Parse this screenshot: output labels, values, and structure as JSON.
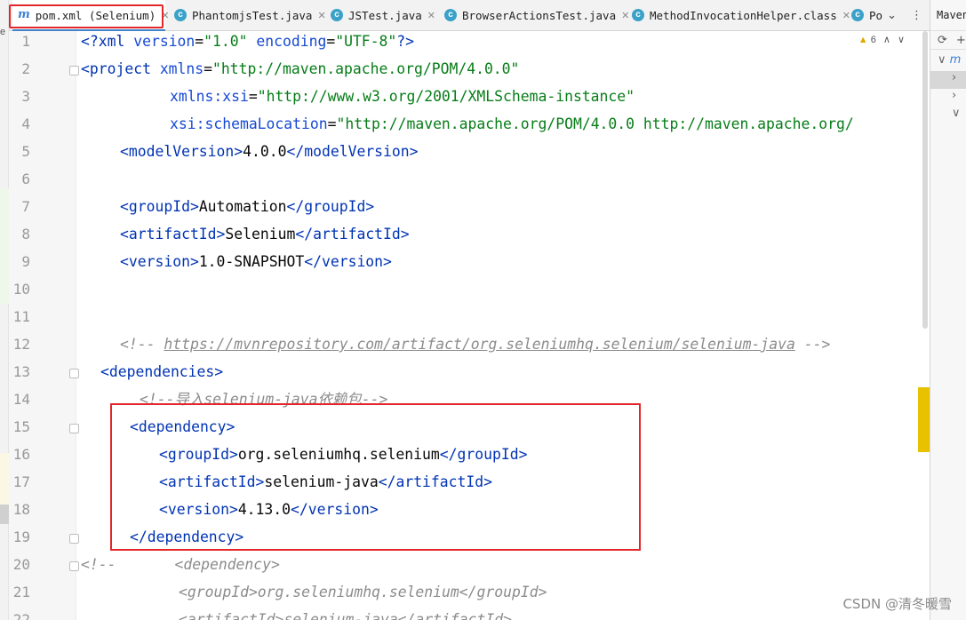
{
  "tabs": [
    {
      "label": "pom.xml (Selenium)",
      "icon": "maven-file-icon",
      "active": true
    },
    {
      "label": "PhantomjsTest.java",
      "icon": "java-class-icon"
    },
    {
      "label": "JSTest.java",
      "icon": "java-class-icon"
    },
    {
      "label": "BrowserActionsTest.java",
      "icon": "java-class-icon"
    },
    {
      "label": "MethodInvocationHelper.class",
      "icon": "java-class-icon"
    },
    {
      "label": "Po",
      "icon": "java-class-icon"
    }
  ],
  "left_strip_label": "e",
  "inspection": {
    "warning_count": "6"
  },
  "maven_panel": {
    "title": "Maven"
  },
  "lines": [
    "1",
    "2",
    "3",
    "4",
    "5",
    "6",
    "7",
    "8",
    "9",
    "10",
    "11",
    "12",
    "13",
    "14",
    "15",
    "16",
    "17",
    "18",
    "19",
    "20",
    "21",
    "22"
  ],
  "code": {
    "l1_a": "<?xml ",
    "l1_b": "version",
    "l1_c": "=",
    "l1_d": "\"1.0\"",
    "l1_e": " encoding",
    "l1_f": "=",
    "l1_g": "\"UTF-8\"",
    "l1_h": "?>",
    "l2_a": "<project ",
    "l2_b": "xmlns",
    "l2_c": "=",
    "l2_d": "\"http://maven.apache.org/POM/4.0.0\"",
    "l3_a": "xmlns:",
    "l3_b": "xsi",
    "l3_c": "=",
    "l3_d": "\"http://www.w3.org/2001/XMLSchema-instance\"",
    "l4_a": "xsi",
    "l4_b": ":schemaLocation",
    "l4_c": "=",
    "l4_d": "\"http://maven.apache.org/POM/4.0.0 http://maven.apache.org/",
    "l5_tag_open": "<modelVersion>",
    "l5_text": "4.0.0",
    "l5_tag_close": "</modelVersion>",
    "l7_tag_open": "<groupId>",
    "l7_text": "Automation",
    "l7_tag_close": "</groupId>",
    "l8_tag_open": "<artifactId>",
    "l8_text": "Selenium",
    "l8_tag_close": "</artifactId>",
    "l9_tag_open": "<version>",
    "l9_text": "1.0-SNAPSHOT",
    "l9_tag_close": "</version>",
    "l12_a": "<!-- ",
    "l12_link": "https://mvnrepository.com/artifact/org.seleniumhq.selenium/selenium-java",
    "l12_b": " -->",
    "l13": "<dependencies>",
    "l14": "<!--导入selenium-java依赖包-->",
    "l15": "<dependency>",
    "l16_tag_open": "<groupId>",
    "l16_text": "org.seleniumhq.selenium",
    "l16_tag_close": "</groupId>",
    "l17_tag_open": "<artifactId>",
    "l17_text": "selenium-java",
    "l17_tag_close": "</artifactId>",
    "l18_tag_open": "<version>",
    "l18_text": "4.13.0",
    "l18_tag_close": "</version>",
    "l19": "</dependency>",
    "l20_a": "<!--",
    "l20_b": "<dependency>",
    "l21": "<groupId>org.seleniumhq.selenium</groupId>",
    "l22": "<artifactId>selenium-java</artifactId>"
  },
  "watermark": "CSDN @清冬暖雪"
}
